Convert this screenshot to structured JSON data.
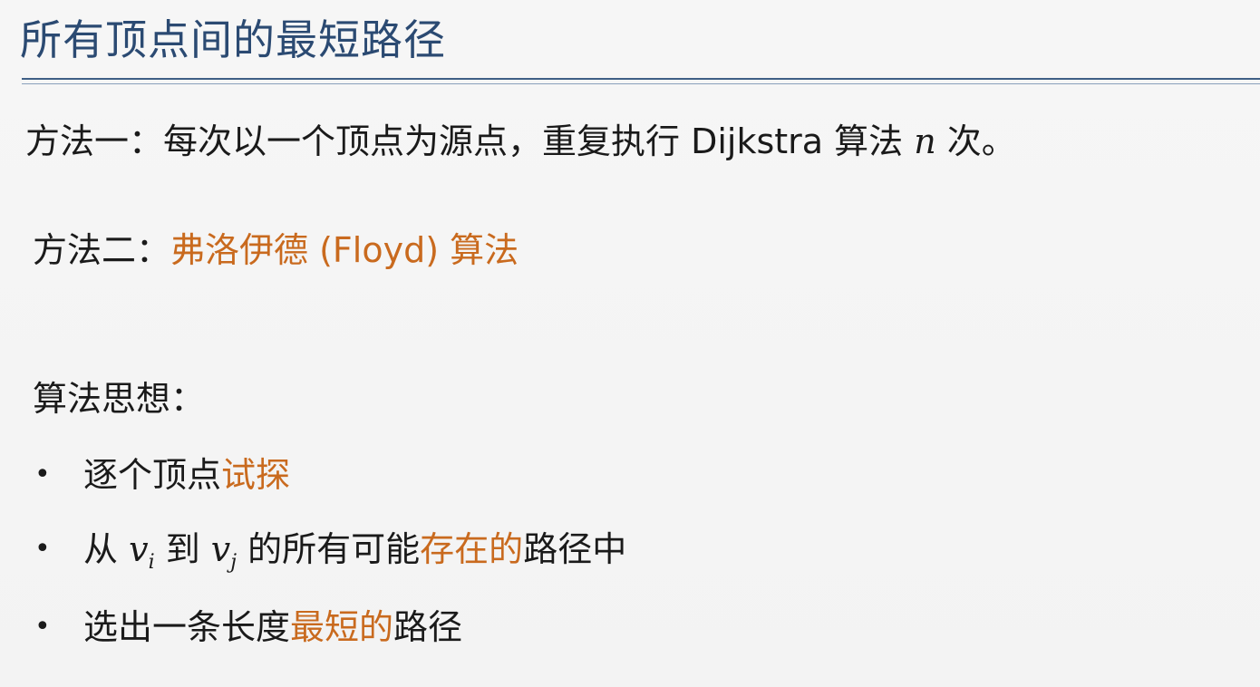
{
  "title": "所有顶点间的最短路径",
  "method1": {
    "text_before": "方法一：每次以一个顶点为源点，重复执行 Dijkstra 算法 ",
    "variable": "n",
    "text_after": " 次。"
  },
  "method2": {
    "label": "方法二：",
    "highlight": "弗洛伊德 (Floyd) 算法"
  },
  "idea": {
    "heading": "算法思想："
  },
  "bullets": {
    "symbol": "•",
    "b1": {
      "plain": "逐个顶点",
      "highlight": "试探"
    },
    "b2": {
      "from": "从 ",
      "v1": "v",
      "v1_sub": "i",
      "to": " 到 ",
      "v2": "v",
      "v2_sub": "j",
      "middle": " 的所有可能",
      "highlight": "存在的",
      "end": "路径中"
    },
    "b3": {
      "plain": "选出一条长度",
      "highlight": "最短的",
      "end": "路径"
    }
  },
  "colors": {
    "title": "#2b4a72",
    "highlight": "#c96a1e",
    "rule": "#3f5f86",
    "text": "#1a1a1a"
  }
}
